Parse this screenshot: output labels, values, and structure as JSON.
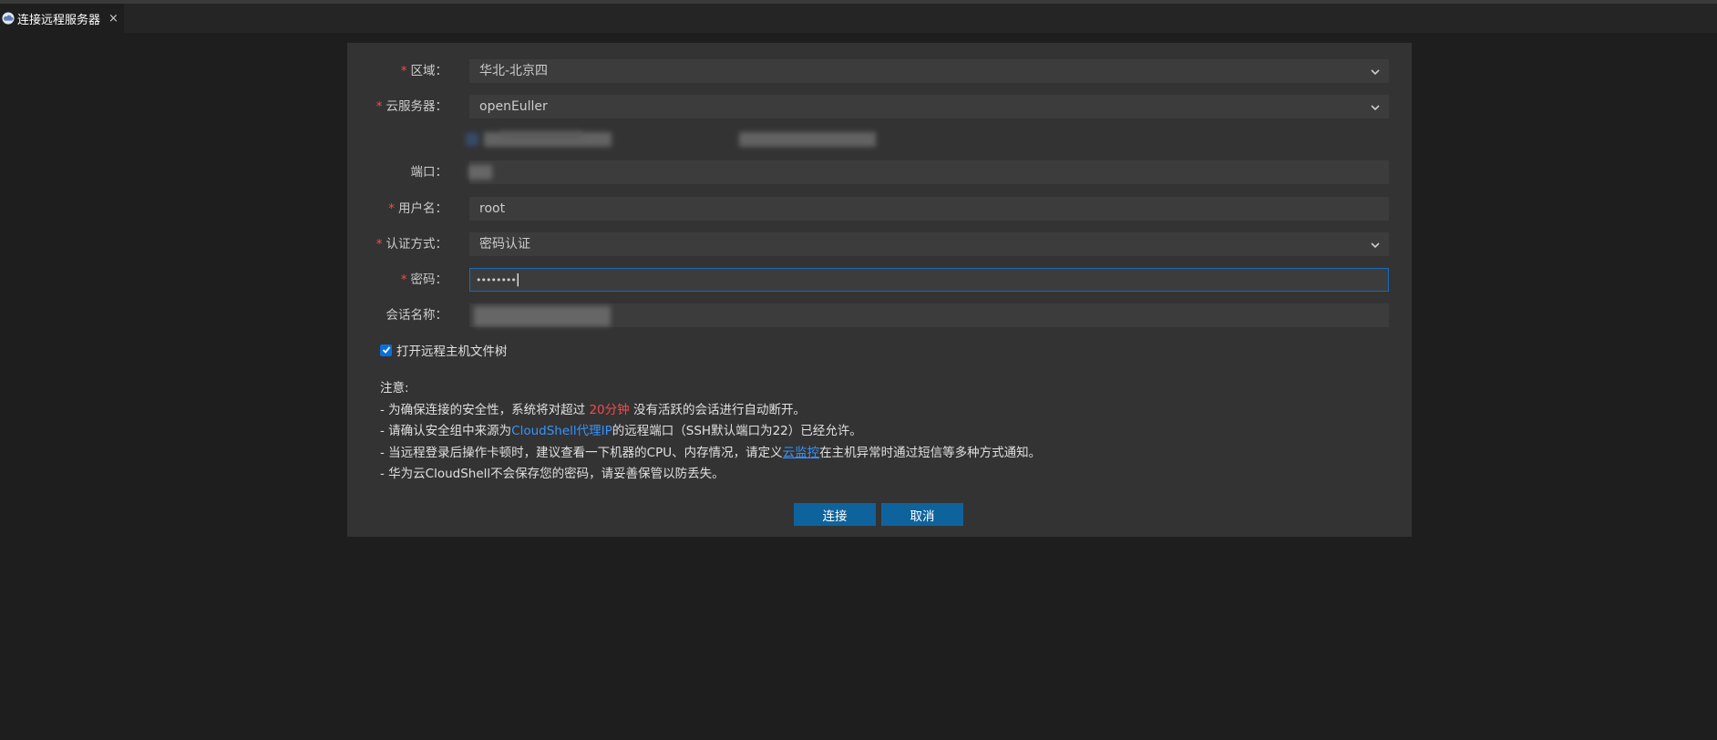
{
  "tab": {
    "title": "连接远程服务器",
    "close": "×"
  },
  "form": {
    "required_mark": "*",
    "region": {
      "label": "区域：",
      "value": "华北-北京四"
    },
    "server": {
      "label": "云服务器：",
      "value": "openEuller"
    },
    "port": {
      "label": "端口："
    },
    "username": {
      "label": "用户名：",
      "value": "root"
    },
    "auth": {
      "label": "认证方式：",
      "value": "密码认证"
    },
    "password": {
      "label": "密码：",
      "value": "••••••••"
    },
    "session": {
      "label": "会话名称："
    },
    "open_tree": {
      "label": "打开远程主机文件树",
      "checked": true
    }
  },
  "notes": {
    "title": "注意:",
    "line1_a": "- 为确保连接的安全性，系统将对超过 ",
    "line1_highlight": "20分钟",
    "line1_b": " 没有活跃的会话进行自动断开。",
    "line2_a": "- 请确认安全组中来源为",
    "line2_highlight": "CloudShell代理IP",
    "line2_b": "的远程端口（SSH默认端口为22）已经允许。",
    "line3_a": "- 当远程登录后操作卡顿时，建议查看一下机器的CPU、内存情况，请定义",
    "line3_link": "云监控",
    "line3_b": "在主机异常时通过短信等多种方式通知。",
    "line4": "- 华为云CloudShell不会保存您的密码，请妥善保管以防丢失。"
  },
  "buttons": {
    "connect": "连接",
    "cancel": "取消"
  },
  "colors": {
    "accent": "#0e639c",
    "required": "#f14c4c",
    "link": "#3794ff",
    "panel": "#333333"
  },
  "icons": {
    "tab": "cloud-icon",
    "select": "chevron-down-icon"
  }
}
